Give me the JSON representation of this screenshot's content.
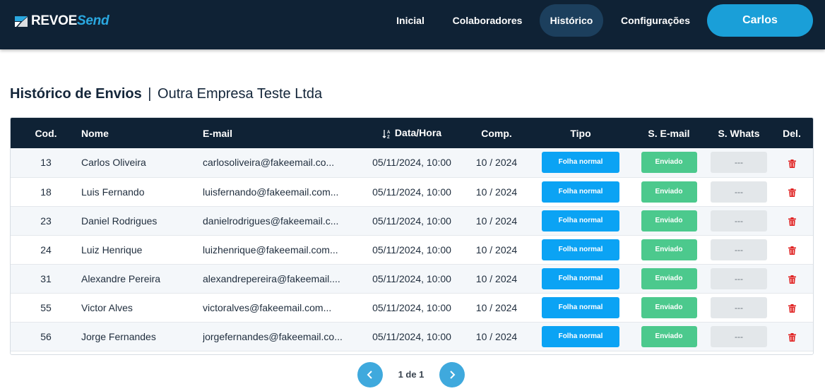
{
  "brand": {
    "part1": "REVOE",
    "part2": "Send",
    "accent": "#2aa8e0"
  },
  "nav": {
    "items": [
      {
        "label": "Inicial",
        "active": false
      },
      {
        "label": "Colaboradores",
        "active": false
      },
      {
        "label": "Histórico",
        "active": true
      },
      {
        "label": "Configurações",
        "active": false
      }
    ],
    "user": "Carlos"
  },
  "page": {
    "title": "Histórico de Envios",
    "separator": "|",
    "company": "Outra Empresa Teste Ltda"
  },
  "table": {
    "headers": {
      "cod": "Cod.",
      "nome": "Nome",
      "email": "E-mail",
      "data": "Data/Hora",
      "comp": "Comp.",
      "tipo": "Tipo",
      "s_email": "S. E-mail",
      "s_whats": "S. Whats",
      "del": "Del."
    },
    "rows": [
      {
        "cod": "13",
        "nome": "Carlos Oliveira",
        "email": "carlosoliveira@fakeemail.co...",
        "data": "05/11/2024, 10:00",
        "comp": "10 / 2024",
        "tipo": "Folha normal",
        "s_email": "Enviado",
        "s_whats": "---"
      },
      {
        "cod": "18",
        "nome": "Luis Fernando",
        "email": "luisfernando@fakeemail.com...",
        "data": "05/11/2024, 10:00",
        "comp": "10 / 2024",
        "tipo": "Folha normal",
        "s_email": "Enviado",
        "s_whats": "---"
      },
      {
        "cod": "23",
        "nome": "Daniel Rodrigues",
        "email": "danielrodrigues@fakeemail.c...",
        "data": "05/11/2024, 10:00",
        "comp": "10 / 2024",
        "tipo": "Folha normal",
        "s_email": "Enviado",
        "s_whats": "---"
      },
      {
        "cod": "24",
        "nome": "Luiz Henrique",
        "email": "luizhenrique@fakeemail.com...",
        "data": "05/11/2024, 10:00",
        "comp": "10 / 2024",
        "tipo": "Folha normal",
        "s_email": "Enviado",
        "s_whats": "---"
      },
      {
        "cod": "31",
        "nome": "Alexandre Pereira",
        "email": "alexandrepereira@fakeemail....",
        "data": "05/11/2024, 10:00",
        "comp": "10 / 2024",
        "tipo": "Folha normal",
        "s_email": "Enviado",
        "s_whats": "---"
      },
      {
        "cod": "55",
        "nome": "Victor Alves",
        "email": "victoralves@fakeemail.com...",
        "data": "05/11/2024, 10:00",
        "comp": "10 / 2024",
        "tipo": "Folha normal",
        "s_email": "Enviado",
        "s_whats": "---"
      },
      {
        "cod": "56",
        "nome": "Jorge Fernandes",
        "email": "jorgefernandes@fakeemail.co...",
        "data": "05/11/2024, 10:00",
        "comp": "10 / 2024",
        "tipo": "Folha normal",
        "s_email": "Enviado",
        "s_whats": "---"
      }
    ]
  },
  "pagination": {
    "label": "1 de 1"
  },
  "icons": {
    "sort": "sort-ascending-icon",
    "delete": "trash-icon",
    "prev": "chevron-left-icon",
    "next": "chevron-right-icon"
  },
  "colors": {
    "header_bg": "#0f2235",
    "active_nav": "#1c3f5d",
    "user_btn": "#1a9fd8",
    "tipo_pill": "#0ba3f4",
    "email_pill": "#4cc98d",
    "whats_pill": "#e3e7ea",
    "delete": "#e02424",
    "pager": "#3fa9dd"
  }
}
